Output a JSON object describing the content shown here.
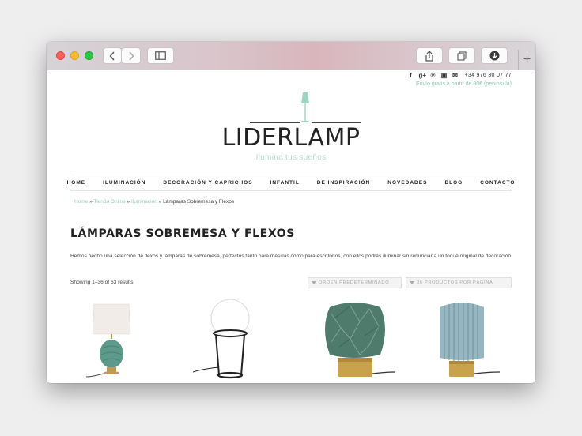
{
  "browser": {
    "traffic_lights": [
      "close",
      "minimize",
      "zoom"
    ],
    "new_tab_label": "+"
  },
  "site": {
    "social_icons": [
      {
        "name": "facebook-icon",
        "glyph": "f"
      },
      {
        "name": "google-plus-icon",
        "glyph": "g+"
      },
      {
        "name": "pinterest-icon",
        "glyph": "℗"
      },
      {
        "name": "instagram-icon",
        "glyph": "▣"
      },
      {
        "name": "mail-icon",
        "glyph": "✉"
      }
    ],
    "phone": "+34 976 30 07 77",
    "shipping_note": "Envío gratis a partir de 80€ (península)",
    "logo_text": "LIDERLAMP",
    "tagline": "Ilumina tus sueños",
    "accent_color": "#8fc6b4"
  },
  "nav": {
    "items": [
      "HOME",
      "ILUMINACIÓN",
      "DECORACIÓN Y CAPRICHOS",
      "INFANTIL",
      "DE INSPIRACIÓN",
      "NOVEDADES",
      "BLOG",
      "CONTACTO"
    ]
  },
  "breadcrumb": {
    "items": [
      "Home",
      "Tienda Online",
      "Iluminación"
    ],
    "separator": "»",
    "current": "Lámparas Sobremesa y Flexos"
  },
  "category": {
    "title": "LÁMPARAS SOBREMESA Y FLEXOS",
    "description": "Hemos hecho una selección de flexos y lámparas de sobremesa, perfectos tanto para mesillas como para escritorios, con ellos podrás iluminar sin renunciar a un toque original de decoración."
  },
  "listing": {
    "result_count": "Showing 1–36 of 63 results",
    "order_select": "ORDEN PREDETERMINADO",
    "per_page_select": "36 PRODUCTOS POR PÁGINA"
  },
  "products": [
    {
      "name": "ceramic-green-lamp"
    },
    {
      "name": "white-globe-lamp"
    },
    {
      "name": "green-glass-lamp"
    },
    {
      "name": "blue-glass-lamp"
    }
  ]
}
